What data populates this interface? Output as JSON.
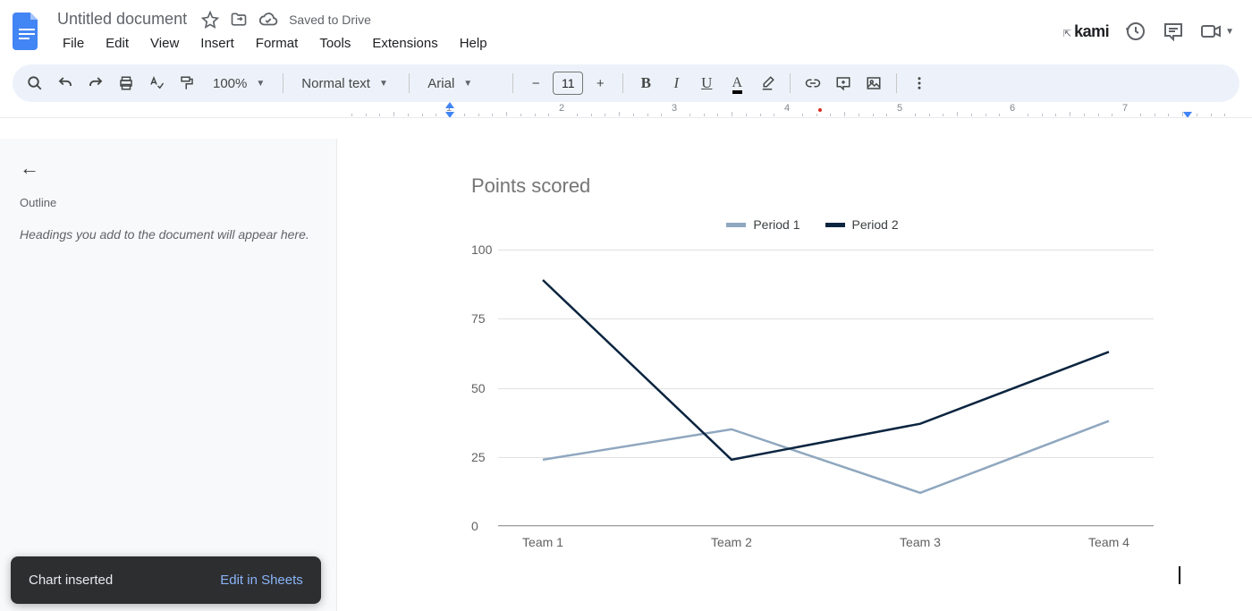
{
  "header": {
    "title": "Untitled document",
    "saved": "Saved to Drive",
    "kami": "kami"
  },
  "menu": {
    "file": "File",
    "edit": "Edit",
    "view": "View",
    "insert": "Insert",
    "format": "Format",
    "tools": "Tools",
    "extensions": "Extensions",
    "help": "Help"
  },
  "toolbar": {
    "zoom": "100%",
    "style": "Normal text",
    "font": "Arial",
    "size": "11"
  },
  "sidebar": {
    "title": "Outline",
    "hint": "Headings you add to the document will appear here."
  },
  "toast": {
    "msg": "Chart inserted",
    "action": "Edit in Sheets"
  },
  "chart_data": {
    "type": "line",
    "title": "Points scored",
    "categories": [
      "Team 1",
      "Team 2",
      "Team 3",
      "Team 4"
    ],
    "series": [
      {
        "name": "Period 1",
        "color": "#8fa7bf",
        "values": [
          24,
          35,
          12,
          38
        ]
      },
      {
        "name": "Period 2",
        "color": "#0b2540",
        "values": [
          89,
          24,
          37,
          63
        ]
      }
    ],
    "ylim": [
      0,
      100
    ],
    "yticks": [
      0,
      25,
      50,
      75,
      100
    ],
    "xlabel": "",
    "ylabel": ""
  },
  "ruler": {
    "labels": [
      "1",
      "2",
      "3",
      "4",
      "5",
      "6",
      "7"
    ]
  }
}
